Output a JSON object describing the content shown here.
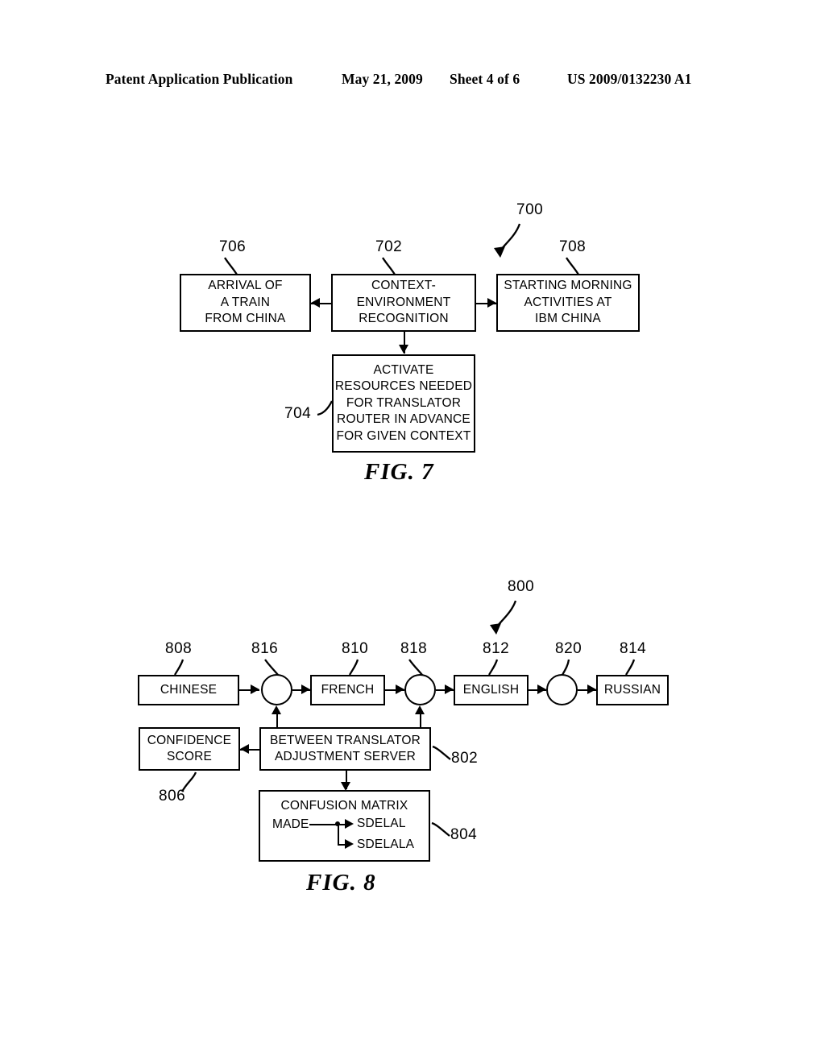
{
  "header": {
    "publication": "Patent Application Publication",
    "date": "May 21, 2009",
    "sheet": "Sheet 4 of 6",
    "patent_number": "US 2009/0132230 A1"
  },
  "figures": [
    {
      "id": "fig7",
      "caption": "FIG. 7",
      "diagram_ref": "700",
      "boxes": [
        {
          "ref": "706",
          "lines": [
            "ARRIVAL OF",
            "A TRAIN",
            "FROM CHINA"
          ]
        },
        {
          "ref": "702",
          "lines": [
            "CONTEXT-",
            "ENVIRONMENT",
            "RECOGNITION"
          ]
        },
        {
          "ref": "708",
          "lines": [
            "STARTING MORNING",
            "ACTIVITIES AT",
            "IBM CHINA"
          ]
        },
        {
          "ref": "704",
          "lines": [
            "ACTIVATE",
            "RESOURCES NEEDED",
            "FOR TRANSLATOR",
            "ROUTER IN ADVANCE",
            "FOR GIVEN CONTEXT"
          ]
        }
      ]
    },
    {
      "id": "fig8",
      "caption": "FIG. 8",
      "diagram_ref": "800",
      "boxes": [
        {
          "ref": "808",
          "lines": [
            "CHINESE"
          ]
        },
        {
          "ref": "810",
          "lines": [
            "FRENCH"
          ]
        },
        {
          "ref": "812",
          "lines": [
            "ENGLISH"
          ]
        },
        {
          "ref": "814",
          "lines": [
            "RUSSIAN"
          ]
        },
        {
          "ref": "806",
          "lines": [
            "CONFIDENCE",
            "SCORE"
          ]
        },
        {
          "ref": "802",
          "lines": [
            "BETWEEN TRANSLATOR",
            "ADJUSTMENT SERVER"
          ]
        },
        {
          "ref": "804",
          "lines": [
            "CONFUSION MATRIX"
          ]
        }
      ],
      "junctions": [
        {
          "ref": "816"
        },
        {
          "ref": "818"
        },
        {
          "ref": "820"
        }
      ],
      "confusion_matrix": {
        "source": "MADE",
        "targets": [
          "SDELAL",
          "SDELALA"
        ]
      }
    }
  ]
}
